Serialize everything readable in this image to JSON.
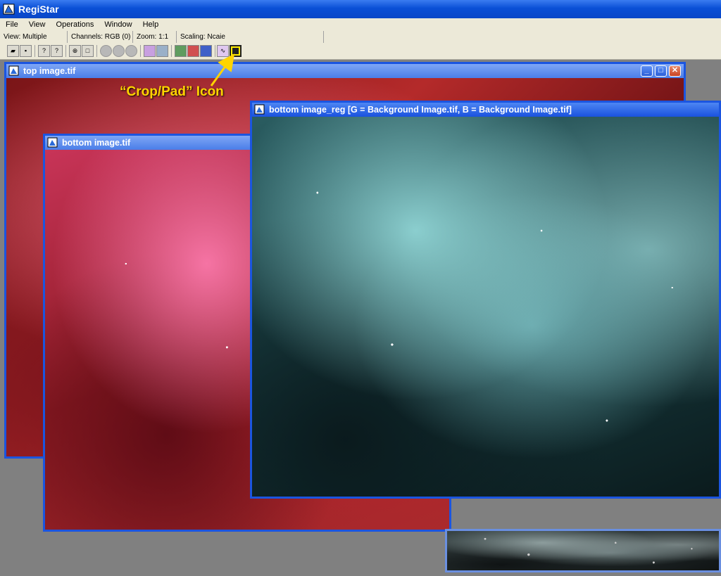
{
  "app": {
    "title": "RegiStar"
  },
  "menu": [
    "File",
    "View",
    "Operations",
    "Window",
    "Help"
  ],
  "status": {
    "view": "View: Multiple",
    "channels": "Channels: RGB (0)",
    "zoom": "Zoom: 1:1",
    "scaling": "Scaling: Ncaie"
  },
  "windows": {
    "top": {
      "title": "top image.tif"
    },
    "bottom": {
      "title": "bottom image.tif"
    },
    "reg": {
      "title": "bottom image_reg [G = Background Image.tif, B = Background Image.tif]"
    }
  },
  "window_controls": {
    "minimize": "_",
    "maximize": "□",
    "close": "✕"
  },
  "annotation": {
    "text": "“Crop/Pad” Icon"
  },
  "colors": {
    "titlebar": "#0a4fd6",
    "window_border": "#1b55e0",
    "annotation": "#ffd400",
    "desktop": "#808080"
  },
  "toolbar_icons": [
    "open-icon",
    "save-icon",
    "help-icon",
    "context-help-icon",
    "zoom-icon",
    "fit-icon",
    "circle-1-icon",
    "circle-2-icon",
    "circle-3-icon",
    "register-icon",
    "grid-icon",
    "combine-icon",
    "color-icon",
    "channel-icon",
    "curve-icon",
    "crop-pad-icon"
  ]
}
